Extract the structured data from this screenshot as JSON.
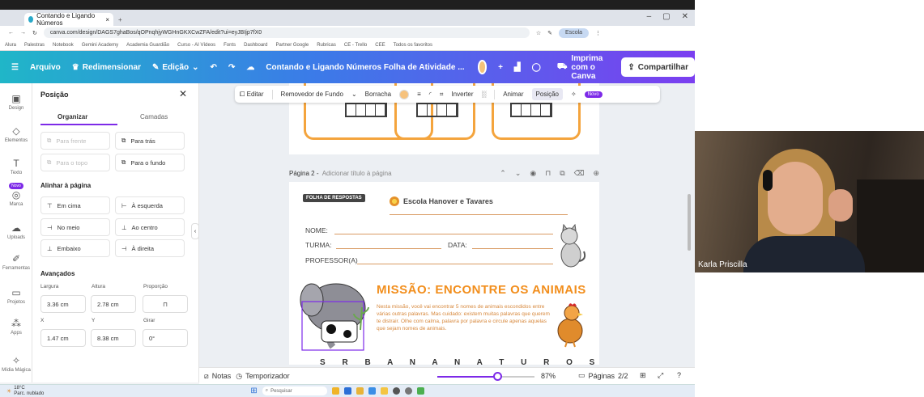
{
  "browser": {
    "tab_title": "Contando e Ligando Números",
    "url": "canva.com/design/DAGS7ghaBos/qOPnqhjyWGHnGKXCwZFA/edit?ui=eyJBIjp7fX0",
    "profile_label": "Escola",
    "bookmarks": [
      "Alura",
      "Palestras",
      "Notebook",
      "Gemini Academy",
      "Academia Guardião",
      "Curso - AI Vídeos",
      "Fonts",
      "Dashboard",
      "Partner Google",
      "Rubricas",
      "CE - Trello",
      "CEE",
      "Todos os favoritos"
    ]
  },
  "canva_bar": {
    "file": "Arquivo",
    "resize": "Redimensionar",
    "edit": "Edição",
    "doc_title": "Contando e Ligando Números Folha de Atividade ...",
    "print": "Imprima com o Canva",
    "share": "Compartilhar"
  },
  "rail": {
    "items": [
      "Design",
      "Elementos",
      "Texto",
      "Marca",
      "Uploads",
      "Ferramentas",
      "Projetos",
      "Apps",
      "Mídia Mágica"
    ],
    "badge": "Novo"
  },
  "panel": {
    "title": "Posição",
    "tabs": [
      "Organizar",
      "Camadas"
    ],
    "arrange": [
      "Para frente",
      "Para trás",
      "Para o topo",
      "Para o fundo"
    ],
    "align_title": "Alinhar à página",
    "align": [
      "Em cima",
      "À esquerda",
      "No meio",
      "Ao centro",
      "Embaixo",
      "À direita"
    ],
    "advanced_title": "Avançados",
    "labels": {
      "width": "Largura",
      "height": "Altura",
      "ratio": "Proporção",
      "x": "X",
      "y": "Y",
      "rotate": "Girar"
    },
    "values": {
      "width": "3.36 cm",
      "height": "2.78 cm",
      "x": "1.47 cm",
      "y": "8.38 cm",
      "rotate": "0°"
    }
  },
  "context_bar": {
    "edit": "Editar",
    "bg_remover": "Removedor de Fundo",
    "eraser": "Borracha",
    "flip": "Inverter",
    "animate": "Animar",
    "position": "Posição",
    "new_badge": "Novo"
  },
  "page2": {
    "label": "Página 2",
    "subtitle": "Adicionar título à página",
    "tag": "FOLHA DE RESPOSTAS",
    "school": "Escola Hanover e Tavares",
    "fields": {
      "name": "NOME:",
      "class": "TURMA:",
      "date": "DATA:",
      "teacher": "PROFESSOR(A)"
    },
    "mission_title": "MISSÃO: ENCONTRE OS ANIMAIS",
    "description": "Nesta missão, você vai encontrar 5 nomes de animais escondidos entre várias outras palavras. Mas cuidado: existem muitas palavras que querem te distrair. Olhe com calma, palavra por palavra e circule apenas aquelas que sejam nomes de animais.",
    "letters": "S R B A N A N A T U R O S L A S I G A"
  },
  "bottom": {
    "notes": "Notas",
    "timer": "Temporizador",
    "zoom": "87%",
    "pages": "Páginas",
    "page_count": "2/2"
  },
  "zoom_level": 0.62,
  "taskbar": {
    "weather": "18°C",
    "weather_sub": "Parc. nublado",
    "search": "Pesquisar"
  },
  "webcam": {
    "name": "Karla Priscilla"
  },
  "colors": {
    "canva_purple": "#7d2ae8",
    "mission_orange": "#f28e1c"
  }
}
